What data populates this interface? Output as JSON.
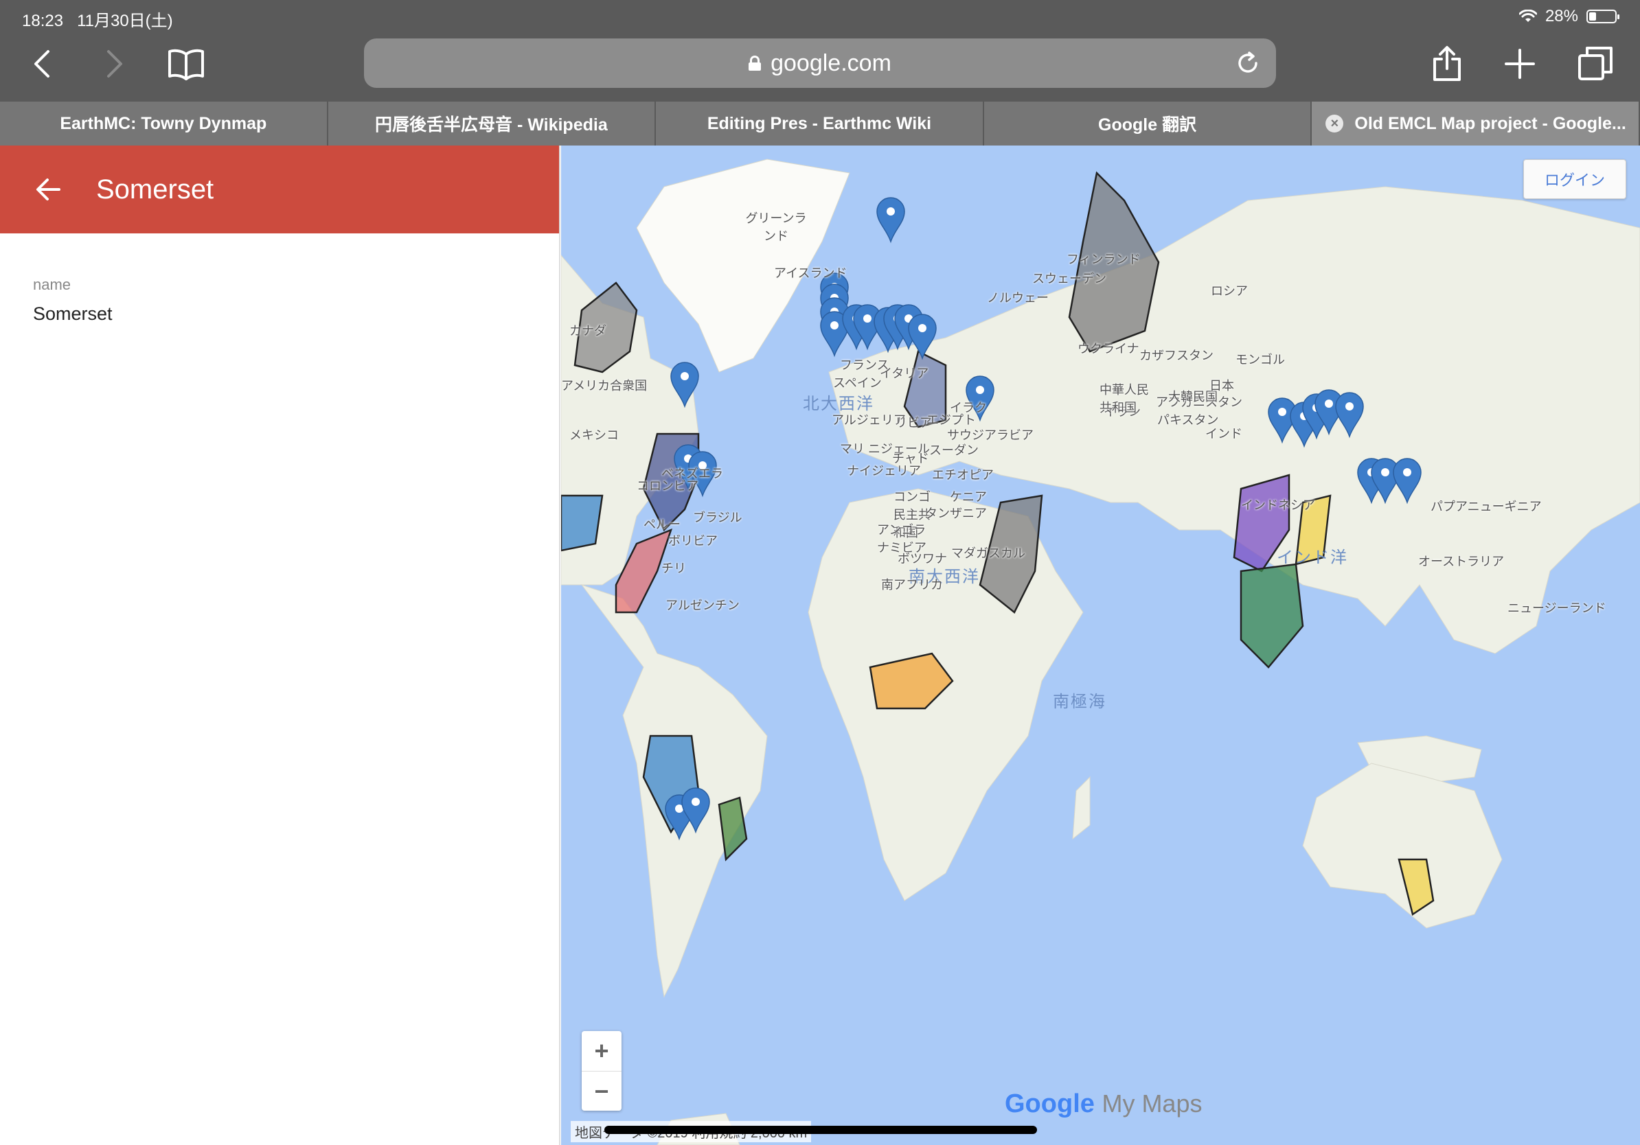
{
  "status_bar": {
    "time": "18:23",
    "date": "11月30日(土)",
    "battery": "28%",
    "battery_level": 0.28
  },
  "browser": {
    "url": "google.com"
  },
  "tabs": [
    {
      "label": "EarthMC: Towny Dynmap"
    },
    {
      "label": "円唇後舌半広母音 - Wikipedia"
    },
    {
      "label": "Editing Pres - Earthmc Wiki"
    },
    {
      "label": "Google 翻訳"
    },
    {
      "label": "Old EMCL Map project - Google..."
    }
  ],
  "panel": {
    "title": "Somerset",
    "field_label": "name",
    "field_value": "Somerset"
  },
  "map": {
    "login": "ログイン",
    "zoom_in": "+",
    "zoom_out": "−",
    "brand_google": "Google",
    "brand_mymaps": "My Maps",
    "attribution": "地図データ ©2019   利用規約   2,000 km",
    "labels": {
      "greenland": "グリーンランド",
      "iceland": "アイスランド",
      "finland": "フィンランド",
      "sweden": "スウェーデン",
      "norway": "ノルウェー",
      "russia": "ロシア",
      "canada": "カナダ",
      "usa": "アメリカ合衆国",
      "mexico": "メキシコ",
      "north_atlantic": "北大西洋",
      "south_atlantic": "南大西洋",
      "indian_ocean": "インド洋",
      "southern_ocean": "南極海",
      "kazakhstan": "カザフスタン",
      "mongolia": "モンゴル",
      "ukraine": "ウクライナ",
      "afghanistan": "アフガニスタン",
      "iran": "イラン",
      "pakistan": "パキスタン",
      "india": "インド",
      "algeria": "アルジェリア",
      "libya": "リビア",
      "egypt": "エジプト",
      "mali_niger": "マリ ニジェール",
      "chad": "チャド",
      "sudan": "スーダン",
      "nigeria": "ナイジェリア",
      "ethiopia": "エチオピア",
      "drc": "コンゴ民主共和国",
      "kenya": "ケニア",
      "tanzania": "タンザニア",
      "angola": "アンゴラ",
      "namibia": "ナミビア",
      "botswana": "ボツワナ",
      "madagascar": "マダガスカル",
      "south_africa": "南アフリカ",
      "venezuela": "ベネズエラ",
      "colombia": "コロンビア",
      "peru": "ペルー",
      "brazil": "ブラジル",
      "bolivia": "ボリビア",
      "chile": "チリ",
      "argentina": "アルゼンチン",
      "saudi": "サウジアラビア",
      "iraq": "イラク",
      "china": "中華人民共和国",
      "korea": "大韓民国",
      "japan": "日本",
      "indonesia": "インドネシア",
      "png": "パプアニューギニア",
      "australia": "オーストラリア",
      "nz": "ニュージーランド",
      "france": "フランス",
      "spain": "スペイン",
      "italy": "イタリア"
    }
  }
}
